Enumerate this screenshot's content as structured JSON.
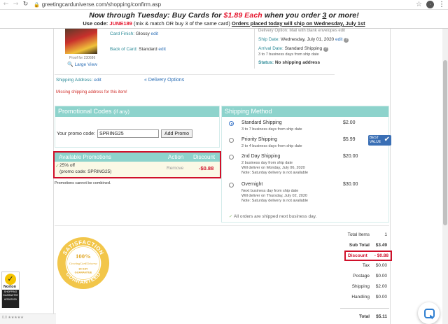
{
  "browser": {
    "url": "greetingcarduniverse.com/shopping/confirm.asp",
    "back_icon": "←",
    "forward_icon": "→",
    "reload_icon": "↻",
    "lock_icon": "🔒",
    "star_icon": "☆",
    "menu_icon": "⋮",
    "profile_initial": "·"
  },
  "banner": {
    "line1_pre": "Now through Tuesday: Buy Cards for ",
    "line1_price": "$1.89 Each",
    "line1_mid": " when you order ",
    "line1_count": "3",
    "line1_post": " or more!",
    "line2_pre": "Use code: ",
    "line2_code": "JUNE189",
    "line2_mid": " (mix & match OR buy 3 of the same card) ",
    "line2_link": "Orders placed today will ship on Wednesday, July 1st"
  },
  "order_item": {
    "proof_label": "Proof for 230686",
    "large_view": "Large View",
    "card_finish_label": "Card Finish:",
    "card_finish_value": "Glossy",
    "back_of_card_label": "Back of Card:",
    "back_of_card_value": "Standard",
    "edit": "edit",
    "delivery_option_text": "Delivery Option: Mail with blank envelopes edit",
    "ship_date_label": "Ship Date:",
    "ship_date_value": "Wednesday, July 01, 2020",
    "arrival_label": "Arrival Date:",
    "arrival_value": "Standard Shipping",
    "arrival_sub": "3 to 7 business days from ship date",
    "status_label": "Status:",
    "status_value": "No shipping address"
  },
  "shipping_address": {
    "label": "Shipping Address:",
    "edit": "edit",
    "delivery_options": "« Delivery Options",
    "missing_warning": "Missing shipping address for this item!"
  },
  "promo_codes": {
    "title": "Promotional Codes",
    "title_suffix": "(if any)",
    "label": "Your promo code:",
    "value": "SPRING25",
    "button": "Add Promo"
  },
  "available_promotions": {
    "title": "Available Promotions",
    "col_action": "Action",
    "col_discount": "Discount",
    "promo_line1": "25% off",
    "promo_line2": "(promo code: SPRING25)",
    "remove": "Remove",
    "discount": "-$0.88",
    "note": "Promotions cannot be combined."
  },
  "shipping_method": {
    "title": "Shipping Method",
    "options": [
      {
        "name": "Standard Shipping",
        "price": "$2.00",
        "sub1": "3 to 7 business days from ship date",
        "sub2": "",
        "sub3": "",
        "selected": true
      },
      {
        "name": "Priority Shipping",
        "price": "$5.99",
        "sub1": "2 to 4 business days from ship date",
        "sub2": "",
        "sub3": "",
        "selected": false
      },
      {
        "name": "2nd Day Shipping",
        "price": "$20.00",
        "sub1": "2 business day from ship date",
        "sub2": "Will deliver on Monday, July 06, 2020",
        "sub3": "Note: Saturday delivery is not available",
        "selected": false
      },
      {
        "name": "Overnight",
        "price": "$30.00",
        "sub1": "Next business day from ship date",
        "sub2": "Will deliver on Thursday, July 02, 2020",
        "sub3": "Note: Saturday delivery is not available",
        "selected": false
      }
    ],
    "best_value_line1": "BEST",
    "best_value_line2": "VALUE",
    "all_next_day": "All orders are shipped next business day."
  },
  "badge": {
    "top_text": "SATISFACTION",
    "percent": "100%",
    "brand": "GreetingCardUniverse",
    "days_line1": "30 DAY",
    "days_line2": "GUARANTEE",
    "bottom_text": "GUARANTEED"
  },
  "totals": {
    "total_items_label": "Total Items",
    "total_items_value": "1",
    "subtotal_label": "Sub Total",
    "subtotal_value": "$3.49",
    "discount_label": "Discount",
    "discount_value": "- $0.88",
    "tax_label": "Tax",
    "tax_value": "$0.00",
    "postage_label": "Postage",
    "postage_value": "$0.00",
    "shipping_label": "Shipping",
    "shipping_value": "$2.00",
    "handling_label": "Handling",
    "handling_value": "$0.00",
    "total_label": "Total",
    "total_value": "$5.11"
  },
  "norton": {
    "word": "Norton",
    "line1": "SHOPPING",
    "line2": "GUARANTEE",
    "date": "6/30/2020"
  },
  "rating": "0.0 ★★★★★",
  "colors": {
    "teal": "#8dd3cc",
    "red": "#d0102a",
    "link": "#2c6fb6",
    "label": "#2b8a97"
  }
}
